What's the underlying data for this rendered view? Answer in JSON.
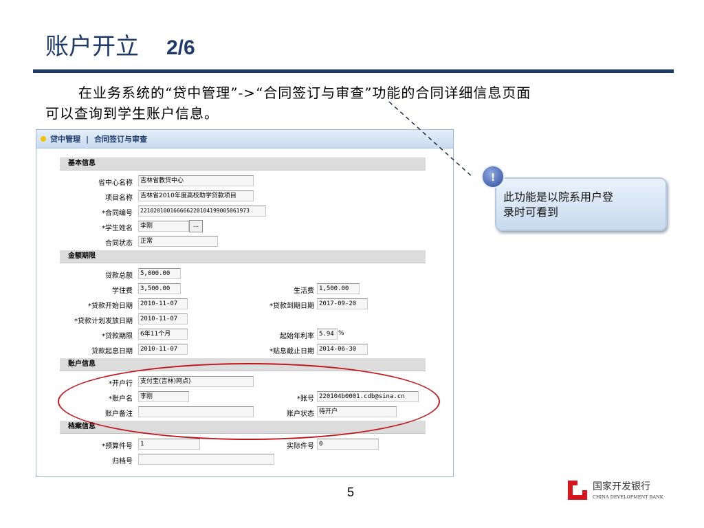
{
  "slide": {
    "title": "账户开立",
    "page_fraction": "2/6",
    "intro_line1": "在业务系统的“贷中管理”->“合同签订与审查”功能的合同详细信息页面",
    "intro_line2": "可以查询到学生账户信息。",
    "page_number": "5"
  },
  "app": {
    "breadcrumb_1": "贷中管理",
    "breadcrumb_sep": "|",
    "breadcrumb_2": "合同签订与审查"
  },
  "sections": {
    "basic": "基本信息",
    "amount": "金额期限",
    "account": "账户信息",
    "archive": "档案信息"
  },
  "basic": {
    "center_label": "省中心名称",
    "center_value": "吉林省教贷中心",
    "project_label": "项目名称",
    "project_value": "吉林省2010年度高校助学贷款项目",
    "contract_label": "*合同编号",
    "contract_value": "22102010016666622010419900506197З",
    "student_label": "*学生姓名",
    "student_value": "李刚",
    "student_btn": "...",
    "status_label": "合同状态",
    "status_value": "正常"
  },
  "amount": {
    "total_label": "贷款总额",
    "total_value": "5,000.00",
    "tuition_label": "学住费",
    "tuition_value": "3,500.00",
    "living_label": "生活费",
    "living_value": "1,500.00",
    "start_label": "*贷款开始日期",
    "start_value": "2010-11-07",
    "due_label": "*贷款到期日期",
    "due_value": "2017-09-20",
    "plan_label": "*贷款计划发放日期",
    "plan_value": "2010-11-07",
    "term_label": "*贷款期限",
    "term_value": "6年11个月",
    "rate_label": "起始年利率",
    "rate_value": "5.94",
    "rate_unit": "%",
    "interest_label": "贷款起息日期",
    "interest_value": "2010-11-07",
    "subsidy_label": "*贴息截止日期",
    "subsidy_value": "2014-06-30"
  },
  "account": {
    "bank_label": "*开户行",
    "bank_value": "支付宝(吉林)网点)",
    "name_label": "*账户名",
    "name_value": "李刚",
    "number_label": "*账号",
    "number_value": "220104b0001.cdb@sina.cn",
    "remark_label": "账户备注",
    "remark_value": "",
    "acct_status_label": "账户状态",
    "acct_status_value": "待开户"
  },
  "archive": {
    "budget_label": "*预算件号",
    "budget_value": "1",
    "actual_label": "实际件号",
    "actual_value": "0",
    "file_label": "归档号",
    "file_value": ""
  },
  "callout": {
    "badge": "!",
    "line1": "此功能是以院系用户登",
    "line2": "录时可看到"
  },
  "logo": {
    "cn": "国家开发银行",
    "en": "CHINA DEVELOPMENT BANK"
  },
  "colors": {
    "title": "#1f3a68",
    "highlight_ellipse": "#c0171e",
    "logo_red": "#d5161d"
  }
}
